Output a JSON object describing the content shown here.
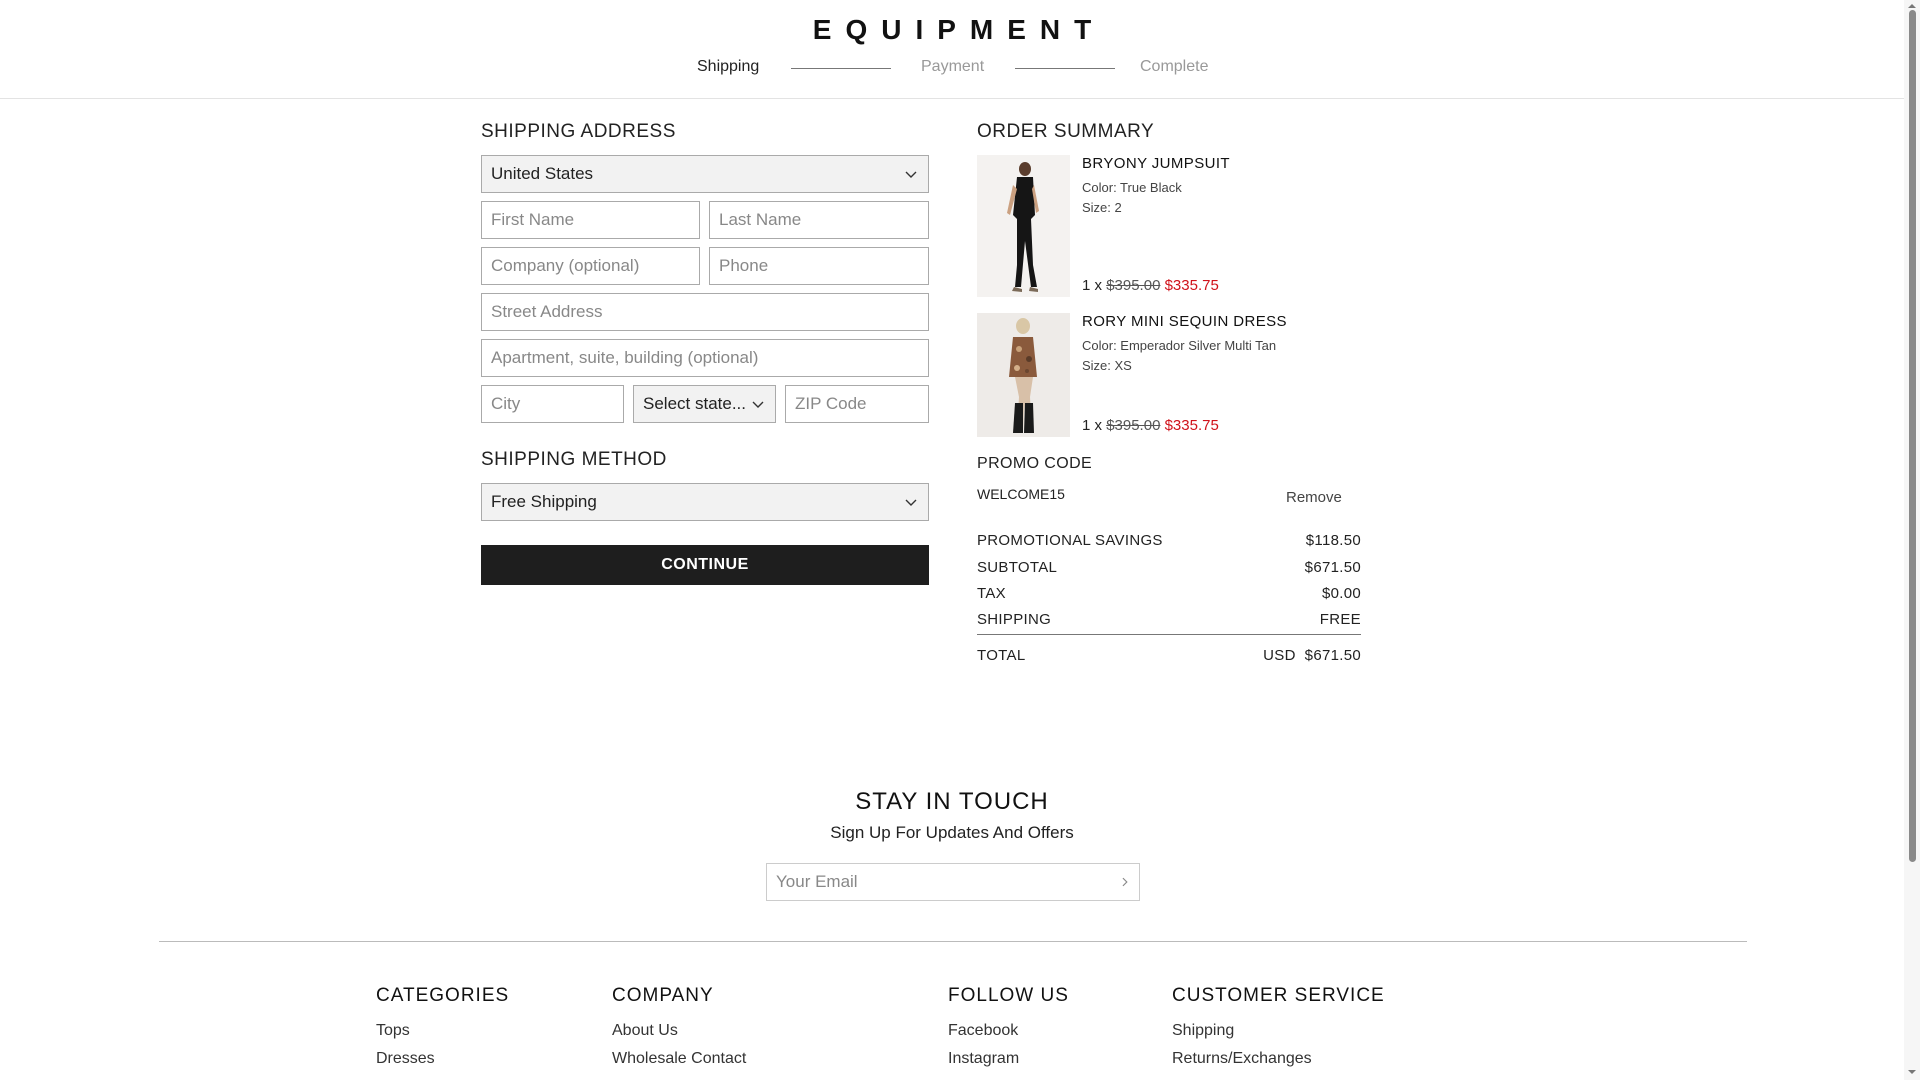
{
  "header": {
    "logo": "EQUIPMENT",
    "steps": [
      {
        "label": "Shipping",
        "active": true
      },
      {
        "label": "Payment",
        "active": false
      },
      {
        "label": "Complete",
        "active": false
      }
    ]
  },
  "shipping_address": {
    "title": "SHIPPING ADDRESS",
    "country": "United States",
    "first_name_placeholder": "First Name",
    "last_name_placeholder": "Last Name",
    "company_placeholder": "Company (optional)",
    "phone_placeholder": "Phone",
    "street_placeholder": "Street Address",
    "apartment_placeholder": "Apartment, suite, building (optional)",
    "city_placeholder": "City",
    "state_select": "Select state...",
    "zip_placeholder": "ZIP Code"
  },
  "shipping_method": {
    "title": "SHIPPING METHOD",
    "selected": "Free Shipping"
  },
  "continue_label": "CONTINUE",
  "order_summary": {
    "title": "ORDER SUMMARY",
    "items": [
      {
        "name": "BRYONY JUMPSUIT",
        "color": "Color: True Black",
        "size": "Size: 2",
        "qty": "1 x",
        "original": "$395.00",
        "price": "$335.75"
      },
      {
        "name": "RORY MINI SEQUIN DRESS",
        "color": "Color: Emperador Silver Multi Tan",
        "size": "Size: XS",
        "qty": "1 x",
        "original": "$395.00",
        "price": "$335.75"
      }
    ],
    "promo_title": "PROMO CODE",
    "promo_code": "WELCOME15",
    "remove_label": "Remove",
    "rows": [
      {
        "label": "PROMOTIONAL SAVINGS",
        "value": "$118.50"
      },
      {
        "label": "SUBTOTAL",
        "value": "$671.50"
      },
      {
        "label": "TAX",
        "value": "$0.00"
      },
      {
        "label": "SHIPPING",
        "value": "FREE"
      }
    ],
    "total_label": "TOTAL",
    "total_currency": "USD",
    "total_value": "$671.50"
  },
  "newsletter": {
    "title": "STAY IN TOUCH",
    "subtitle": "Sign Up For Updates And Offers",
    "email_placeholder": "Your Email"
  },
  "footer": {
    "columns": [
      {
        "title": "CATEGORIES",
        "links": [
          "Tops",
          "Dresses"
        ]
      },
      {
        "title": "COMPANY",
        "links": [
          "About Us",
          "Wholesale Contact"
        ]
      },
      {
        "title": "FOLLOW US",
        "links": [
          "Facebook",
          "Instagram"
        ]
      },
      {
        "title": "CUSTOMER SERVICE",
        "links": [
          "Shipping",
          "Returns/Exchanges"
        ]
      }
    ]
  },
  "colors": {
    "sale": "#d0121b",
    "button": "#1e1e1e",
    "select_bg": "#f2f2f2"
  }
}
